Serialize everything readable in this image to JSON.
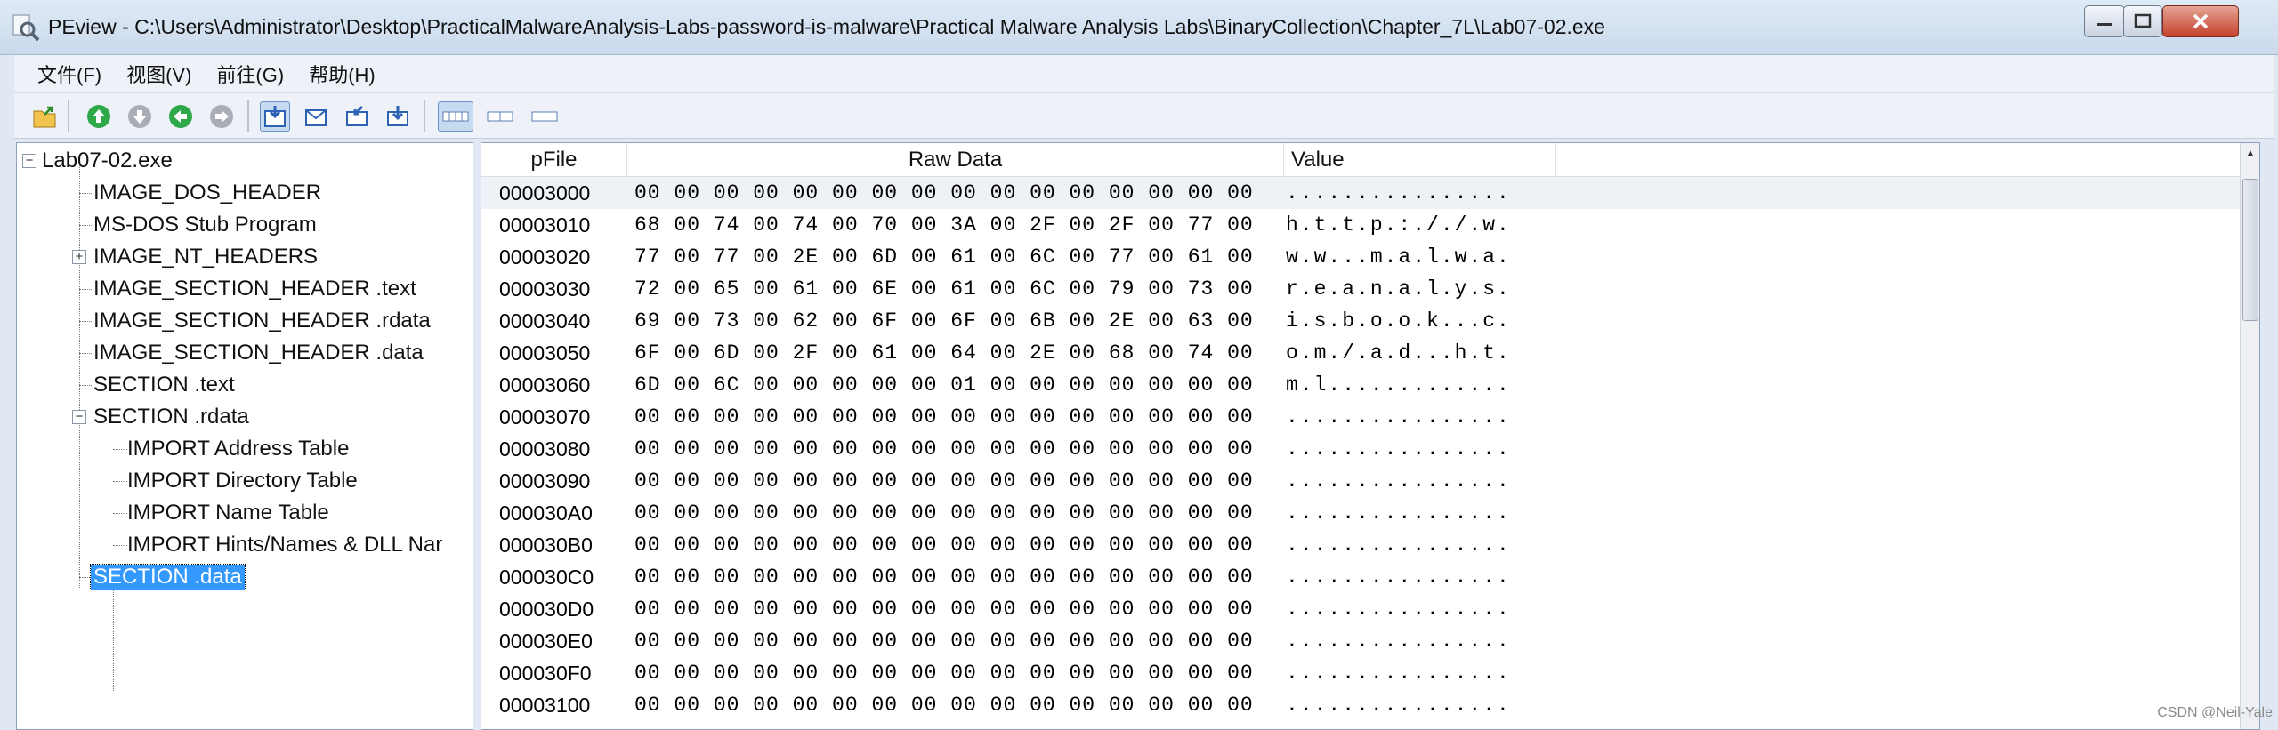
{
  "window": {
    "title": "PEview - C:\\Users\\Administrator\\Desktop\\PracticalMalwareAnalysis-Labs-password-is-malware\\Practical Malware Analysis Labs\\BinaryCollection\\Chapter_7L\\Lab07-02.exe",
    "app_icon": "magnifier-file-icon"
  },
  "menu": [
    "文件(F)",
    "视图(V)",
    "前往(G)",
    "帮助(H)"
  ],
  "toolbar_icons": [
    "open-file-icon",
    "up-arrow-icon",
    "down-arrow-icon",
    "back-arrow-icon",
    "forward-arrow-icon",
    "view-hex-icon",
    "view-mail-icon",
    "view-import-icon",
    "view-export-icon",
    "bytes-mode-icon",
    "word-mode-icon",
    "dword-mode-icon"
  ],
  "tree": {
    "root": "Lab07-02.exe",
    "items": [
      "IMAGE_DOS_HEADER",
      "MS-DOS Stub Program",
      "IMAGE_NT_HEADERS",
      "IMAGE_SECTION_HEADER .text",
      "IMAGE_SECTION_HEADER .rdata",
      "IMAGE_SECTION_HEADER .data",
      "SECTION .text",
      "SECTION .rdata",
      "IMPORT Address Table",
      "IMPORT Directory Table",
      "IMPORT Name Table",
      "IMPORT Hints/Names & DLL Nar",
      "SECTION .data"
    ],
    "selected": "SECTION .data"
  },
  "hex": {
    "headers": {
      "pfile": "pFile",
      "raw": "Raw Data",
      "value": "Value"
    },
    "rows": [
      {
        "addr": "00003000",
        "bytes": "00 00 00 00 00 00 00 00  00 00 00 00 00 00 00 00",
        "ascii": "................"
      },
      {
        "addr": "00003010",
        "bytes": "68 00 74 00 74 00 70 00  3A 00 2F 00 2F 00 77 00",
        "ascii": "h.t.t.p.:././.w."
      },
      {
        "addr": "00003020",
        "bytes": "77 00 77 00 2E 00 6D 00  61 00 6C 00 77 00 61 00",
        "ascii": "w.w...m.a.l.w.a."
      },
      {
        "addr": "00003030",
        "bytes": "72 00 65 00 61 00 6E 00  61 00 6C 00 79 00 73 00",
        "ascii": "r.e.a.n.a.l.y.s."
      },
      {
        "addr": "00003040",
        "bytes": "69 00 73 00 62 00 6F 00  6F 00 6B 00 2E 00 63 00",
        "ascii": "i.s.b.o.o.k...c."
      },
      {
        "addr": "00003050",
        "bytes": "6F 00 6D 00 2F 00 61 00  64 00 2E 00 68 00 74 00",
        "ascii": "o.m./.a.d...h.t."
      },
      {
        "addr": "00003060",
        "bytes": "6D 00 6C 00 00 00 00 00  01 00 00 00 00 00 00 00",
        "ascii": "m.l............."
      },
      {
        "addr": "00003070",
        "bytes": "00 00 00 00 00 00 00 00  00 00 00 00 00 00 00 00",
        "ascii": "................"
      },
      {
        "addr": "00003080",
        "bytes": "00 00 00 00 00 00 00 00  00 00 00 00 00 00 00 00",
        "ascii": "................"
      },
      {
        "addr": "00003090",
        "bytes": "00 00 00 00 00 00 00 00  00 00 00 00 00 00 00 00",
        "ascii": "................"
      },
      {
        "addr": "000030A0",
        "bytes": "00 00 00 00 00 00 00 00  00 00 00 00 00 00 00 00",
        "ascii": "................"
      },
      {
        "addr": "000030B0",
        "bytes": "00 00 00 00 00 00 00 00  00 00 00 00 00 00 00 00",
        "ascii": "................"
      },
      {
        "addr": "000030C0",
        "bytes": "00 00 00 00 00 00 00 00  00 00 00 00 00 00 00 00",
        "ascii": "................"
      },
      {
        "addr": "000030D0",
        "bytes": "00 00 00 00 00 00 00 00  00 00 00 00 00 00 00 00",
        "ascii": "................"
      },
      {
        "addr": "000030E0",
        "bytes": "00 00 00 00 00 00 00 00  00 00 00 00 00 00 00 00",
        "ascii": "................"
      },
      {
        "addr": "000030F0",
        "bytes": "00 00 00 00 00 00 00 00  00 00 00 00 00 00 00 00",
        "ascii": "................"
      },
      {
        "addr": "00003100",
        "bytes": "00 00 00 00 00 00 00 00  00 00 00 00 00 00 00 00",
        "ascii": "................"
      }
    ]
  },
  "watermark": "CSDN @Neil-Yale",
  "colors": {
    "selection": "#3399ff",
    "titlebar": "#c9d9ec",
    "close": "#c4422c"
  }
}
